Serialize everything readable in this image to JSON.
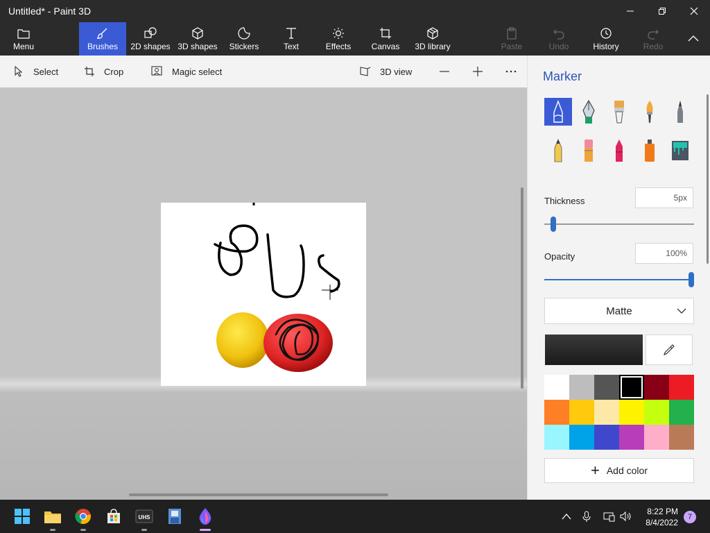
{
  "window": {
    "title": "Untitled* - Paint 3D"
  },
  "ribbon": {
    "menu": "Menu",
    "tabs": [
      "Brushes",
      "2D shapes",
      "3D shapes",
      "Stickers",
      "Text",
      "Effects",
      "Canvas",
      "3D library"
    ],
    "active_tab": "Brushes",
    "paste": "Paste",
    "undo": "Undo",
    "history": "History",
    "redo": "Redo"
  },
  "toolbar": {
    "select": "Select",
    "crop": "Crop",
    "magic_select": "Magic select",
    "view3d": "3D view"
  },
  "panel": {
    "title": "Marker",
    "brushes": [
      "marker",
      "calligraphy-pen",
      "oil-brush",
      "watercolor",
      "pixel-pen",
      "pencil",
      "eraser",
      "crayon",
      "spray-can",
      "fill"
    ],
    "thickness_label": "Thickness",
    "thickness_value": "5px",
    "thickness_level": 0.06,
    "opacity_label": "Opacity",
    "opacity_value": "100%",
    "opacity_level": 1.0,
    "finish": "Matte",
    "current_color": "#1a1a1a",
    "palette": [
      "#ffffff",
      "#bdbdbd",
      "#555555",
      "#000000",
      "#880015",
      "#ed1c24",
      "#ff7f27",
      "#ffc90e",
      "#fde8a8",
      "#fff200",
      "#c4ff0e",
      "#22b14c",
      "#99f6ff",
      "#00a2e8",
      "#3f48cc",
      "#b83dba",
      "#ffaec9",
      "#b97a57"
    ],
    "selected_swatch": 3,
    "add_color": "Add color"
  },
  "taskbar": {
    "time": "8:22 PM",
    "date": "8/4/2022",
    "notifications": "7",
    "apps": [
      "windows-start",
      "file-explorer",
      "chrome",
      "microsoft-store",
      "vhs-app",
      "film-app",
      "paint3d"
    ]
  }
}
